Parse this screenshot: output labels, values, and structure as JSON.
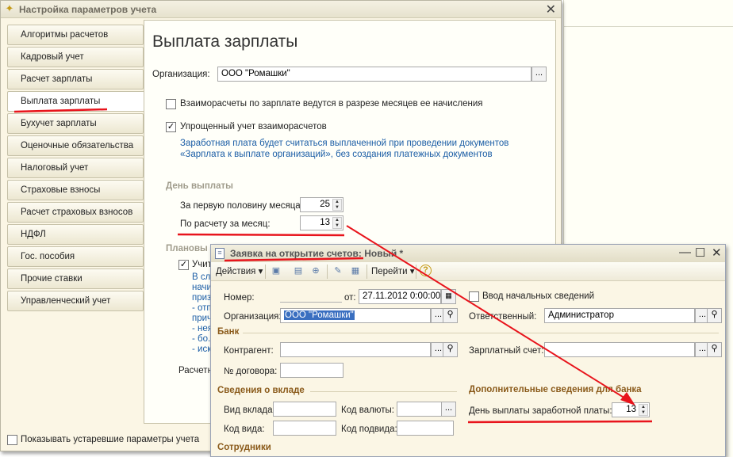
{
  "settings": {
    "window_title": "Настройка параметров учета",
    "nav": [
      {
        "label": "Алгоритмы расчетов"
      },
      {
        "label": "Кадровый учет"
      },
      {
        "label": "Расчет зарплаты"
      },
      {
        "label": "Выплата зарплаты"
      },
      {
        "label": "Бухучет зарплаты"
      },
      {
        "label": "Оценочные обязательства"
      },
      {
        "label": "Налоговый учет"
      },
      {
        "label": "Страховые взносы"
      },
      {
        "label": "Расчет страховых взносов"
      },
      {
        "label": "НДФЛ"
      },
      {
        "label": "Гос. пособия"
      },
      {
        "label": "Прочие ставки"
      },
      {
        "label": "Управленческий учет"
      }
    ],
    "active_nav": "Выплата зарплаты",
    "heading": "Выплата зарплаты",
    "org_label": "Организация:",
    "org_value": "ООО \"Ромашки\"",
    "ellipsis": "...",
    "cb_months": "Взаиморасчеты по зарплате ведутся в разрезе месяцев ее начисления",
    "cb_simplified": "Упрощенный учет взаиморасчетов",
    "info_line1": "Заработная плата будет считаться выплаченной при проведении документов",
    "info_line2": "«Зарплата к выплате организаций», без создания платежных документов",
    "payday_section": "День выплаты",
    "first_half_label": "За первую половину месяца:",
    "first_half_value": "25",
    "month_calc_label": "По расчету за месяц:",
    "month_calc_value": "13",
    "planned_section": "Плановы",
    "cb_partial": "Учит",
    "partial_lines": [
      "В сл",
      "начи",
      "приз",
      "- отп",
      "прич",
      "- нея",
      "- бо.",
      "- иск"
    ],
    "calc_label": "Расчетн",
    "show_obsolete": "Показывать устаревшие параметры учета"
  },
  "request": {
    "window_title": "Заявка на открытие счетов: Новый *",
    "actions": "Действия",
    "goto": "Перейти",
    "help": "?",
    "number_label": "Номер:",
    "from_label": "от:",
    "date_value": "27.11.2012 0:00:00",
    "initial_data": "Ввод начальных сведений",
    "org_label": "Организация:",
    "org_value": "ООО \"Ромашки\"",
    "responsible_label": "Ответственный:",
    "responsible_value": "Администратор",
    "bank_section": "Банк",
    "contractor_label": "Контрагент:",
    "salary_account_label": "Зарплатный счет:",
    "contract_label": "№ договора:",
    "deposit_section": "Сведения о вкладе",
    "deposit_type_label": "Вид вклада:",
    "currency_code_label": "Код валюты:",
    "type_code_label": "Код вида:",
    "subtype_code_label": "Код подвида:",
    "extra_section": "Дополнительные сведения для банка",
    "salary_day_label": "День выплаты заработной платы:",
    "salary_day_value": "13",
    "employees_section": "Сотрудники"
  },
  "colors": {
    "annotation_red": "#e8141c",
    "link_blue": "#1c5ea6",
    "section_brown": "#8a5a1a"
  }
}
